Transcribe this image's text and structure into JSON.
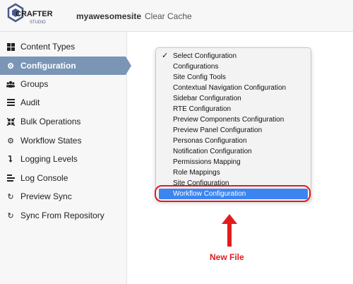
{
  "header": {
    "logo_text": "CRAFTER",
    "logo_sub": "STUDIO",
    "site_name": "myawesomesite",
    "clear_cache_label": "Clear Cache"
  },
  "sidebar": {
    "items": [
      {
        "label": "Content Types",
        "icon": "grid-icon",
        "active": false
      },
      {
        "label": "Configuration",
        "icon": "gear-icon",
        "active": true
      },
      {
        "label": "Groups",
        "icon": "users-icon",
        "active": false
      },
      {
        "label": "Audit",
        "icon": "list-icon",
        "active": false
      },
      {
        "label": "Bulk Operations",
        "icon": "compress-icon",
        "active": false
      },
      {
        "label": "Workflow States",
        "icon": "cogs-icon",
        "active": false
      },
      {
        "label": "Logging Levels",
        "icon": "level-down-icon",
        "active": false
      },
      {
        "label": "Log Console",
        "icon": "align-left-icon",
        "active": false
      },
      {
        "label": "Preview Sync",
        "icon": "refresh-icon",
        "active": false
      },
      {
        "label": "Sync From Repository",
        "icon": "refresh-icon",
        "active": false
      }
    ]
  },
  "config_dropdown": {
    "options": [
      {
        "label": "Select Configuration",
        "checked": true
      },
      {
        "label": "Configurations"
      },
      {
        "label": "Site Config Tools"
      },
      {
        "label": "Contextual Navigation Configuration"
      },
      {
        "label": "Sidebar Configuration"
      },
      {
        "label": "RTE Configuration"
      },
      {
        "label": "Preview Components Configuration"
      },
      {
        "label": "Preview Panel Configuration"
      },
      {
        "label": "Personas Configuration"
      },
      {
        "label": "Notification Configuration"
      },
      {
        "label": "Permissions Mapping"
      },
      {
        "label": "Role Mappings"
      },
      {
        "label": "Site Configuration"
      },
      {
        "label": "Workflow Configuration",
        "selected": true
      }
    ],
    "checkmark": "✓"
  },
  "annotation": {
    "label": "New File",
    "color": "#e11c1c"
  },
  "colors": {
    "active_nav": "#7a95b5",
    "selected_option": "#3c85f1"
  }
}
